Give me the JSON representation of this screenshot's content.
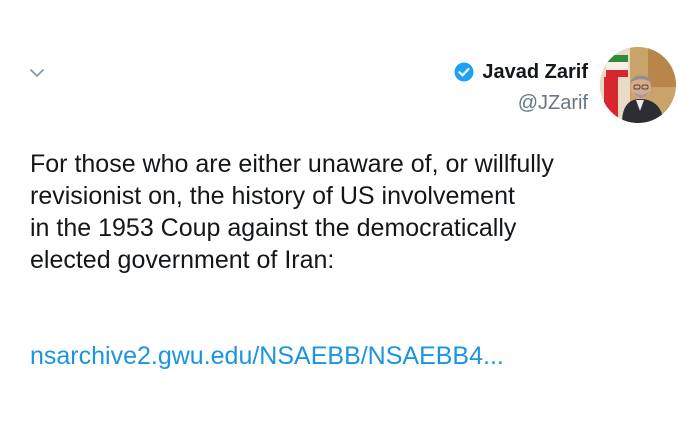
{
  "tweet": {
    "author": {
      "display_name": "Javad Zarif",
      "handle": "@JZarif",
      "verified": true
    },
    "text": "For those who are either unaware of, or willfully\nrevisionist on, the history of US involvement\nin the 1953 Coup against the democratically\nelected government of Iran:",
    "link_text": "nsarchive2.gwu.edu/NSAEBB/NSAEBB4..."
  },
  "icons": {
    "menu": "chevron-down-icon",
    "verified": "verified-badge-icon"
  },
  "colors": {
    "background": "#ffffff",
    "text": "#14171a",
    "handle": "#657786",
    "link": "#1b95e0",
    "verified": "#1da1f2"
  }
}
